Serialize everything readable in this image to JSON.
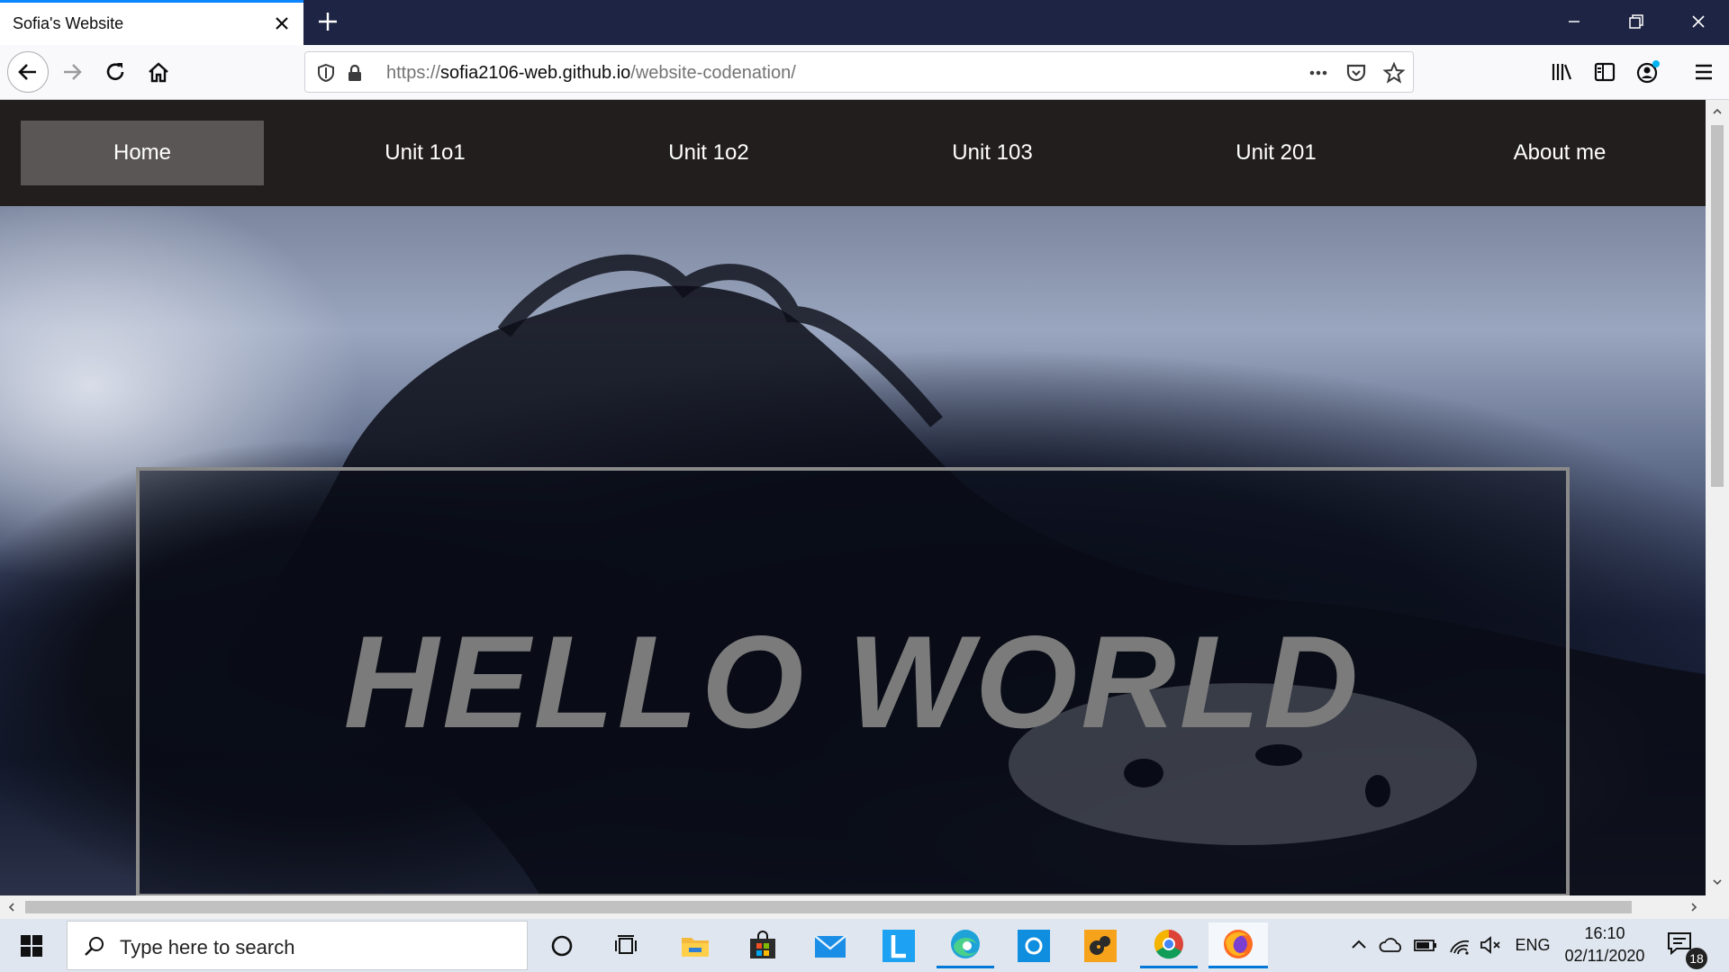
{
  "browser": {
    "tab_title": "Sofia's Website",
    "url_scheme": "https://",
    "url_host": "sofia2106-web.github.io",
    "url_path": "/website-codenation/",
    "accent_color": "#0a84ff",
    "tabbar_color": "#1e2443"
  },
  "site": {
    "nav_items": [
      {
        "label": "Home",
        "active": true
      },
      {
        "label": "Unit 1o1",
        "active": false
      },
      {
        "label": "Unit 1o2",
        "active": false
      },
      {
        "label": "Unit 103",
        "active": false
      },
      {
        "label": "Unit 201",
        "active": false
      },
      {
        "label": "About me",
        "active": false
      }
    ],
    "hero_title": "HELLO WORLD",
    "nav_bg_color": "#231e1e",
    "active_bg_color": "#5a5656"
  },
  "taskbar": {
    "search_placeholder": "Type here to search",
    "language": "ENG",
    "time": "16:10",
    "date": "02/11/2020",
    "notification_count": "18",
    "apps": [
      "cortana-icon",
      "task-view-icon",
      "file-explorer-icon",
      "store-icon",
      "mail-icon",
      "l-app-icon",
      "edge-icon",
      "o-app-icon",
      "game-app-icon",
      "chrome-icon",
      "firefox-icon"
    ]
  }
}
